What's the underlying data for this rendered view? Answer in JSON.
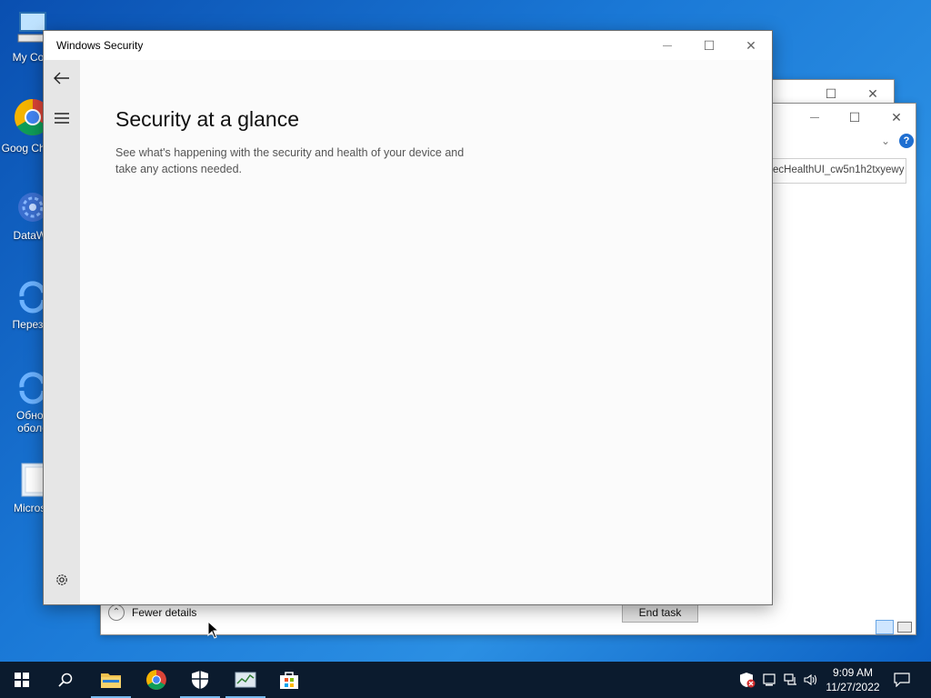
{
  "desktop": {
    "icons": [
      {
        "label": "My Com",
        "icon": "computer-icon"
      },
      {
        "label": "Goog Chrom",
        "icon": "chrome-icon"
      },
      {
        "label": "DataWa",
        "icon": "datawave-icon"
      },
      {
        "label": "Перезаг",
        "icon": "restart-icon"
      },
      {
        "label": "Обнов оболо",
        "icon": "update-icon"
      },
      {
        "label": "Microso",
        "icon": "folder-icon"
      }
    ]
  },
  "background_window": {
    "path_field_value": "ecHealthUI_cw5n1h2txyewy",
    "fewer_details_label": "Fewer details",
    "end_task_label": "End task",
    "help_icon": "?"
  },
  "window": {
    "title": "Windows Security",
    "minimize_icon": "—",
    "maximize_icon": "☐",
    "close_icon": "✕"
  },
  "page": {
    "title": "Security at a glance",
    "description": "See what's happening with the security and health of your device and take any actions needed."
  },
  "taskbar": {
    "items": [
      "start-icon",
      "search-icon",
      "file-explorer-icon",
      "chrome-icon",
      "windows-security-icon",
      "task-manager-icon",
      "store-icon"
    ],
    "clock_time": "9:09 AM",
    "clock_date": "11/27/2022"
  },
  "colors": {
    "desktop": "#1a78d6",
    "taskbar": "#0b1b2e",
    "nav_pane": "#e6e6e6"
  }
}
